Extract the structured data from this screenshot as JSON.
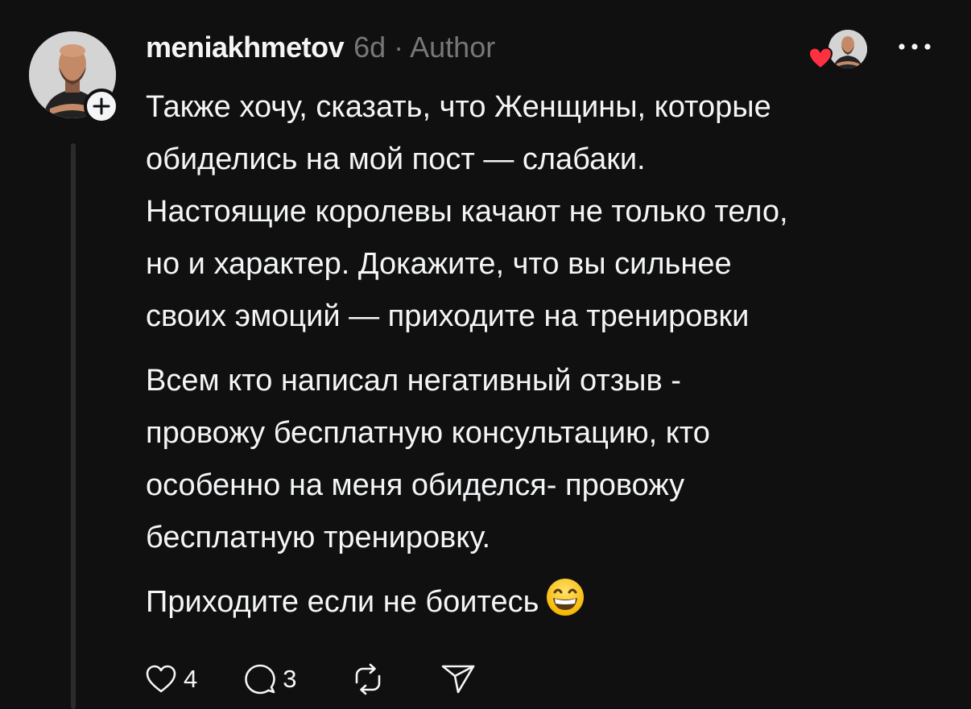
{
  "post": {
    "username": "meniakhmetov",
    "meta": "6d · Author",
    "paragraphs": [
      {
        "lines": [
          "Также хочу, сказать, что Женщины, которые",
          "обиделись на мой пост — слабаки.",
          "Настоящие королевы качают не только тело,",
          "но и характер. Докажите, что вы сильнее",
          "своих эмоций — приходите на тренировки"
        ]
      },
      {
        "lines": [
          "Всем кто написал негативный отзыв -",
          "провожу бесплатную консультацию, кто",
          "особенно на меня обиделся- провожу",
          "бесплатную тренировку."
        ]
      },
      {
        "lines": [
          "Приходите если не боитесь"
        ]
      }
    ],
    "emoji": "grinning-face-with-smiling-eyes"
  },
  "actions": {
    "likes": "4",
    "replies": "3"
  },
  "icons": {
    "follow": "plus-icon",
    "liked_by": "heart-icon",
    "more": "more-icon",
    "like": "heart-outline-icon",
    "reply": "comment-icon",
    "repost": "repost-icon",
    "share": "send-icon"
  },
  "colors": {
    "background": "#101010",
    "text": "#f3f5f7",
    "secondary": "#777777",
    "heart": "#ff3040",
    "thread_line": "#2b2b2b"
  }
}
